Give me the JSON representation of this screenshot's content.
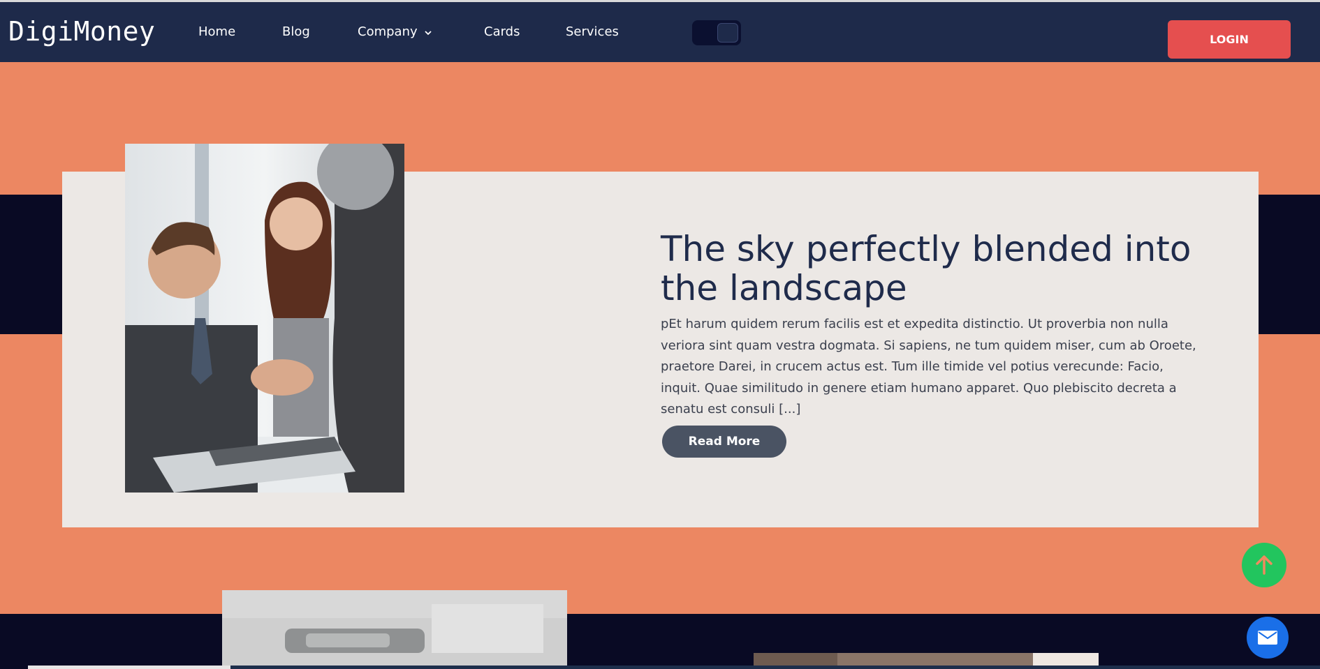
{
  "nav": {
    "logo": "DigiMoney",
    "links": [
      "Home",
      "Blog",
      "Company",
      "Cards",
      "Services"
    ],
    "login_label": "LOGIN"
  },
  "hero": {
    "title": "The sky perfectly blended into the landscape",
    "body": "pEt harum quidem rerum facilis est et expedita distinctio. Ut proverbia non nulla veriora sint quam vestra dogmata. Si sapiens, ne tum quidem miser, cum ab Oroete, praetore Darei, in crucem actus est. Tum ille timide vel potius verecunde: Facio, inquit. Quae similitudo in genere etiam humano apparet. Quo plebiscito decreta a senatu est consuli [...]",
    "button_label": "Read More"
  },
  "icons": {
    "dropdown": "chevron-down-icon",
    "scroll_top": "arrow-up-icon",
    "contact": "mail-icon"
  },
  "colors": {
    "nav_bg": "#1e2a4a",
    "page_bg": "#ec8762",
    "band": "#090a24",
    "card_bg": "#ece8e5",
    "login": "#e54f4f",
    "read_more": "#4a5363",
    "scroll_top": "#22c55e",
    "mail": "#1a6fe8"
  }
}
